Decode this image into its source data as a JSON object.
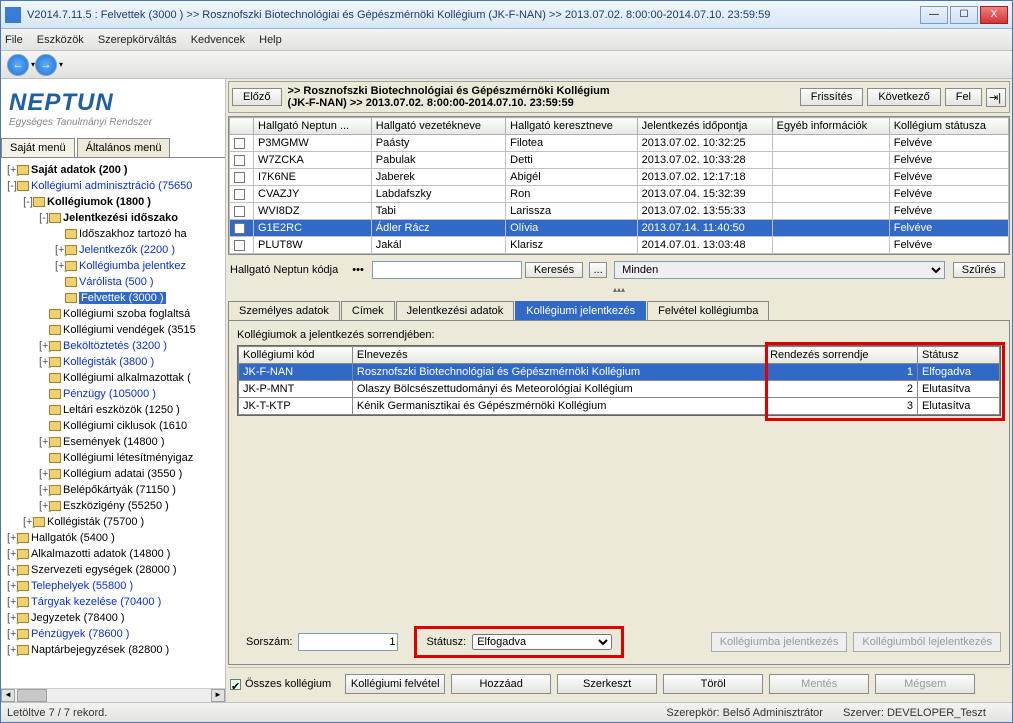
{
  "window": {
    "title": "V2014.7.11.5 : Felvettek (3000  )  >> Rosznofszki Biotechnológiai és Gépészmérnöki Kollégium (JK-F-NAN) >> 2013.07.02. 8:00:00-2014.07.10. 23:59:59"
  },
  "menu": [
    "File",
    "Eszközök",
    "Szerepkörváltás",
    "Kedvencek",
    "Help"
  ],
  "logo": {
    "big": "NEPTUN",
    "sub": "Egységes Tanulmányi Rendszer"
  },
  "left_tabs": [
    "Saját menü",
    "Általános menü"
  ],
  "tree": [
    {
      "pad": 0,
      "icon": true,
      "plus": "+",
      "text": "Saját adatok (200  )",
      "bold": true
    },
    {
      "pad": 0,
      "icon": true,
      "plus": "-",
      "text": "Kollégiumi adminisztráció (75650",
      "link": true
    },
    {
      "pad": 1,
      "icon": true,
      "plus": "-",
      "text": "Kollégiumok (1800  )",
      "bold": true
    },
    {
      "pad": 2,
      "icon": true,
      "plus": "-",
      "text": "Jelentkezési időszako",
      "bold": true
    },
    {
      "pad": 3,
      "icon": true,
      "plus": "",
      "text": "Időszakhoz tartozó ha"
    },
    {
      "pad": 3,
      "icon": true,
      "plus": "+",
      "text": "Jelentkezők (2200  )",
      "link": true
    },
    {
      "pad": 3,
      "icon": true,
      "plus": "+",
      "text": "Kollégiumba jelentkez",
      "link": true
    },
    {
      "pad": 3,
      "icon": true,
      "plus": "",
      "text": "Várólista (500  )",
      "link": true
    },
    {
      "pad": 3,
      "icon": true,
      "plus": "",
      "text": "Felvettek  (3000  )",
      "sel": true
    },
    {
      "pad": 2,
      "icon": true,
      "plus": "",
      "text": "Kollégiumi szoba foglaltsá"
    },
    {
      "pad": 2,
      "icon": true,
      "plus": "",
      "text": "Kollégiumi vendégek (3515"
    },
    {
      "pad": 2,
      "icon": true,
      "plus": "+",
      "text": "Beköltöztetés (3200  )",
      "link": true
    },
    {
      "pad": 2,
      "icon": true,
      "plus": "+",
      "text": "Kollégisták (3800  )",
      "link": true
    },
    {
      "pad": 2,
      "icon": true,
      "plus": "",
      "text": "Kollégiumi alkalmazottak ("
    },
    {
      "pad": 2,
      "icon": true,
      "plus": "",
      "text": "Pénzügy (105000  )",
      "link": true
    },
    {
      "pad": 2,
      "icon": true,
      "plus": "",
      "text": "Leltári eszközök (1250  )"
    },
    {
      "pad": 2,
      "icon": true,
      "plus": "",
      "text": "Kollégiumi ciklusok (1610"
    },
    {
      "pad": 2,
      "icon": true,
      "plus": "+",
      "text": "Események (14800  )"
    },
    {
      "pad": 2,
      "icon": true,
      "plus": "",
      "text": "Kollégiumi létesítményigaz"
    },
    {
      "pad": 2,
      "icon": true,
      "plus": "+",
      "text": "Kollégium adatai (3550  )"
    },
    {
      "pad": 2,
      "icon": true,
      "plus": "+",
      "text": "Belépőkártyák (71150  )"
    },
    {
      "pad": 2,
      "icon": true,
      "plus": "+",
      "text": "Eszközigény (55250  )"
    },
    {
      "pad": 1,
      "icon": true,
      "plus": "+",
      "text": "Kollégisták (75700  )"
    },
    {
      "pad": 0,
      "icon": true,
      "plus": "+",
      "text": "Hallgatók (5400  )"
    },
    {
      "pad": 0,
      "icon": true,
      "plus": "+",
      "text": "Alkalmazotti adatok (14800  )"
    },
    {
      "pad": 0,
      "icon": true,
      "plus": "+",
      "text": "Szervezeti egységek (28000  )"
    },
    {
      "pad": 0,
      "icon": true,
      "plus": "+",
      "text": "Telephelyek (55800  )",
      "link": true
    },
    {
      "pad": 0,
      "icon": true,
      "plus": "+",
      "text": "Tárgyak kezelése (70400  )",
      "link": true
    },
    {
      "pad": 0,
      "icon": true,
      "plus": "+",
      "text": "Jegyzetek (78400  )"
    },
    {
      "pad": 0,
      "icon": true,
      "plus": "+",
      "text": "Pénzügyek (78600  )",
      "link": true
    },
    {
      "pad": 0,
      "icon": true,
      "plus": "+",
      "text": "Naptárbejegyzések (82800  )"
    }
  ],
  "path": {
    "prev": "Előző",
    "line1": ">> Rosznofszki Biotechnológiai és Gépészmérnöki Kollégium",
    "line2": "(JK-F-NAN) >> 2013.07.02. 8:00:00-2014.07.10. 23:59:59",
    "refresh": "Frissítés",
    "next": "Következő",
    "up": "Fel"
  },
  "grid1": {
    "cols": [
      "Hallgató Neptun ...",
      "Hallgató vezetékneve",
      "Hallgató keresztneve",
      "Jelentkezés időpontja",
      "Egyéb információk",
      "Kollégium státusza"
    ],
    "rows": [
      [
        "P3MGMW",
        "Paásty",
        "Filotea",
        "2013.07.02. 10:32:25",
        "",
        "Felvéve"
      ],
      [
        "W7ZCKA",
        "Pabulak",
        "Detti",
        "2013.07.02. 10:33:28",
        "",
        "Felvéve"
      ],
      [
        "I7K6NE",
        "Jaberek",
        "Abigél",
        "2013.07.02. 12:17:18",
        "",
        "Felvéve"
      ],
      [
        "CVAZJY",
        "Labdafszky",
        "Ron",
        "2013.07.04. 15:32:39",
        "",
        "Felvéve"
      ],
      [
        "WVI8DZ",
        "Tabi",
        "Larissza",
        "2013.07.02. 13:55:33",
        "",
        "Felvéve"
      ],
      [
        "G1E2RC",
        "Ádler Rácz",
        "Olívia",
        "2013.07.14. 11:40:50",
        "",
        "Felvéve"
      ],
      [
        "PLUT8W",
        "Jakál",
        "Klarisz",
        "2014.07.01. 13:03:48",
        "",
        "Felvéve"
      ]
    ],
    "selected": 5
  },
  "search": {
    "label": "Hallgató Neptun kódja",
    "btn": "Keresés",
    "ellipsis": "...",
    "all": "Minden",
    "filter": "Szűrés"
  },
  "detail_tabs": [
    "Személyes adatok",
    "Címek",
    "Jelentkezési adatok",
    "Kollégiumi jelentkezés",
    "Felvétel kollégiumba"
  ],
  "detail_active": 3,
  "detail": {
    "title": "Kollégiumok a jelentkezés sorrendjében:"
  },
  "grid2": {
    "cols": [
      "Kollégiumi kód",
      "Elnevezés",
      "Rendezés sorrendje",
      "Státusz"
    ],
    "rows": [
      [
        "JK-F-NAN",
        "Rosznofszki Biotechnológiai és Gépészmérnöki Kollégium",
        "1",
        "Elfogadva"
      ],
      [
        "JK-P-MNT",
        "Olaszy Bölcsészettudományi és Meteorológiai Kollégium",
        "2",
        "Elutasítva"
      ],
      [
        "JK-T-KTP",
        "Kénik Germanisztikai és Gépészmérnöki Kollégium",
        "3",
        "Elutasítva"
      ]
    ],
    "selected": 0
  },
  "bottom": {
    "sorszam_label": "Sorszám:",
    "sorszam": "1",
    "status_label": "Státusz:",
    "status": "Elfogadva",
    "apply": "Kollégiumba jelentkezés",
    "leave": "Kollégiumból lejelentkezés"
  },
  "btnrow": {
    "check": "Összes kollégium",
    "buttons": [
      "Kollégiumi felvétel",
      "Hozzáad",
      "Szerkeszt",
      "Töröl",
      "Mentés",
      "Mégsem"
    ]
  },
  "status": {
    "left": "Letöltve 7 / 7 rekord.",
    "role": "Szerepkör: Belső Adminisztrátor",
    "server": "Szerver: DEVELOPER_Teszt"
  }
}
